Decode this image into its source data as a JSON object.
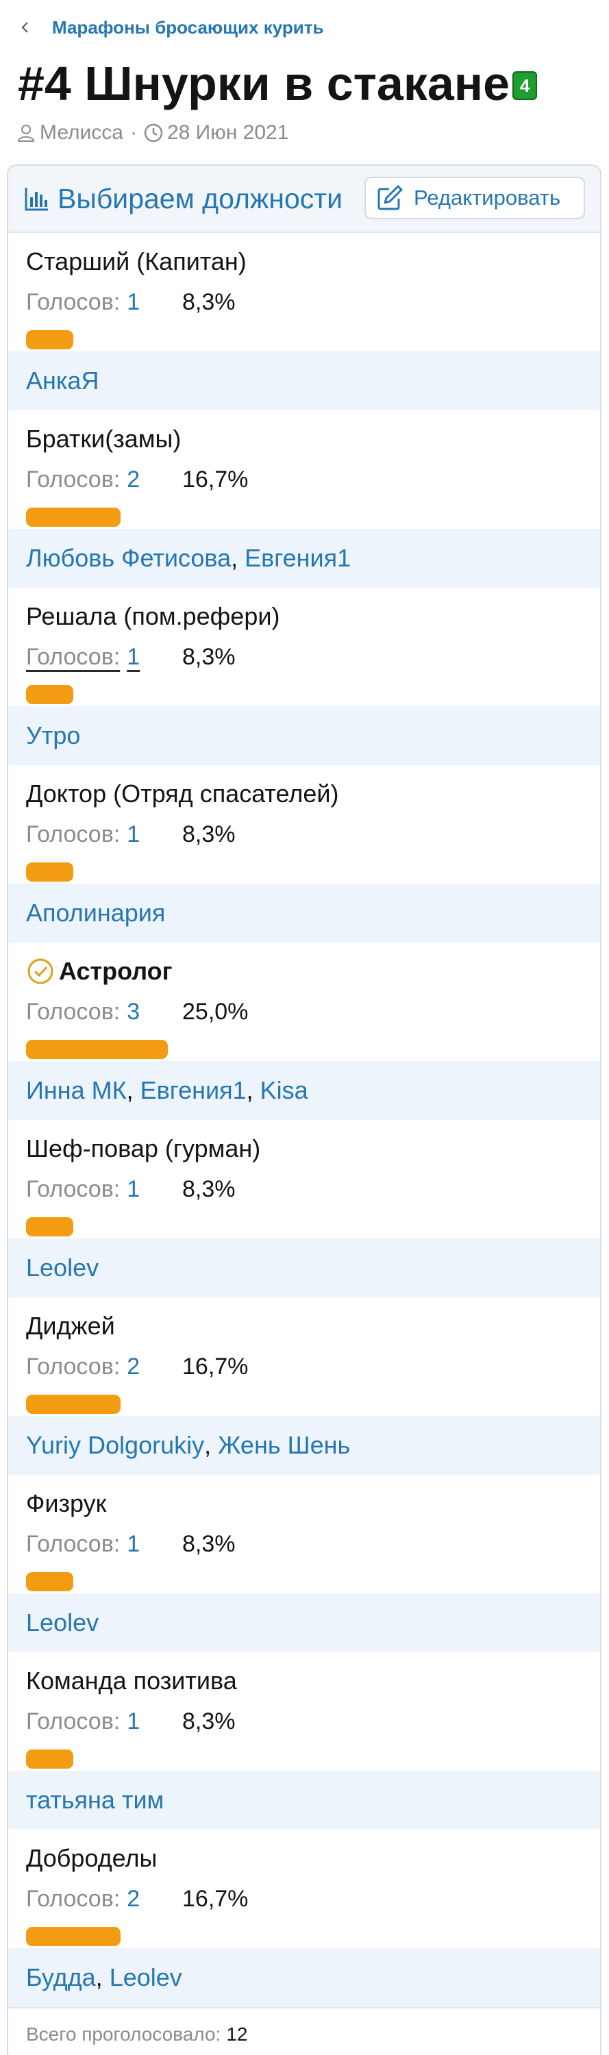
{
  "breadcrumb": {
    "label": "Марафоны бросающих курить"
  },
  "thread": {
    "title": "#4 Шнурки в стакане",
    "badge": "4"
  },
  "meta": {
    "author": "Мелисса",
    "date": "28 Июн 2021"
  },
  "poll": {
    "title": "Выбираем должности",
    "edit_label": "Редактировать",
    "votes_label": "Голосов:",
    "bar_color": "#f39c11",
    "options": [
      {
        "label": "Старший (Капитан)",
        "votes": "1",
        "percent": "8,3%",
        "share": 0.083,
        "voters": [
          "АнкаЯ"
        ]
      },
      {
        "label": "Братки(замы)",
        "votes": "2",
        "percent": "16,7%",
        "share": 0.167,
        "voters": [
          "Любовь Фетисова",
          "Евгения1"
        ]
      },
      {
        "label": "Решала (пом.рефери)",
        "votes": "1",
        "percent": "8,3%",
        "share": 0.083,
        "voters": [
          "Утро"
        ]
      },
      {
        "label": "Доктор (Отряд спасателей)",
        "votes": "1",
        "percent": "8,3%",
        "share": 0.083,
        "voters": [
          "Аполинария"
        ]
      },
      {
        "label": "Астролог",
        "votes": "3",
        "percent": "25,0%",
        "share": 0.25,
        "voters": [
          "Инна МК",
          "Евгения1",
          "Kisa"
        ],
        "selected": true
      },
      {
        "label": "Шеф-повар (гурман)",
        "votes": "1",
        "percent": "8,3%",
        "share": 0.083,
        "voters": [
          "Leolev"
        ]
      },
      {
        "label": "Диджей",
        "votes": "2",
        "percent": "16,7%",
        "share": 0.167,
        "voters": [
          "Yuriy Dolgorukiy",
          "Жень Шень"
        ]
      },
      {
        "label": "Физрук",
        "votes": "1",
        "percent": "8,3%",
        "share": 0.083,
        "voters": [
          "Leolev"
        ]
      },
      {
        "label": "Команда позитива",
        "votes": "1",
        "percent": "8,3%",
        "share": 0.083,
        "voters": [
          "татьяна тим"
        ]
      },
      {
        "label": "Доброделы",
        "votes": "2",
        "percent": "16,7%",
        "share": 0.167,
        "voters": [
          "Будда",
          "Leolev"
        ]
      }
    ],
    "total_label": "Всего проголосовало:",
    "total": "12"
  }
}
